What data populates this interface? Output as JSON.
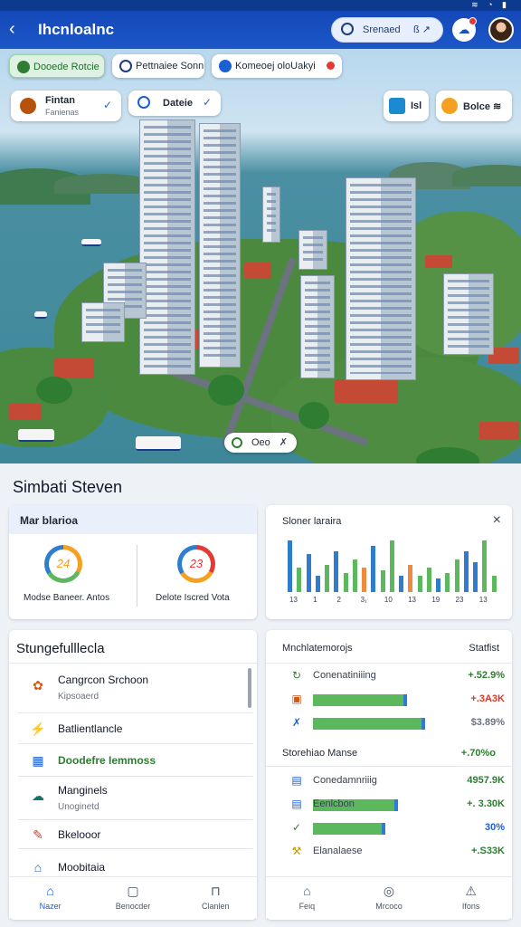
{
  "app": {
    "title": "Ihcnloalnc",
    "search_placeholder": "Srenaed",
    "search_extra": "ß ↗",
    "status_icons": "≋ ◔ ▮"
  },
  "map": {
    "chips_top": [
      {
        "label": "Dooede  Rotcie",
        "color": "#2e7d32"
      },
      {
        "label": "Pettnaiee Sonn",
        "color": "#1f3d7a"
      },
      {
        "label": "Komeoej oloUakyi",
        "color": "#1b5fd1"
      }
    ],
    "cards": [
      {
        "title": "Fintan",
        "subtitle": "Fanienas",
        "check": "✓"
      },
      {
        "title": "Dateie",
        "subtitle": "",
        "check": "✓"
      }
    ],
    "right_chips": [
      {
        "label": "Isl"
      },
      {
        "label": "Bolce ≋"
      }
    ],
    "badge": {
      "label": "Oeo",
      "suffix": "✗"
    }
  },
  "section": {
    "title": "Simbati Steven"
  },
  "metrics_panel": {
    "title": "Mar blarioa",
    "rings": [
      {
        "value": "24",
        "label": "Modse Baneer. Antos",
        "colors": [
          "#f4a020",
          "#5cb85c",
          "#2f7dd1"
        ]
      },
      {
        "value": "23",
        "label": "Delote Iscred Vota",
        "colors": [
          "#e53935",
          "#f4a020",
          "#2f7dd1"
        ]
      }
    ]
  },
  "chart_panel": {
    "close": "×",
    "chart_data": {
      "type": "bar",
      "title": "Sloner laraira",
      "tick_labels": [
        "13",
        "1",
        "2",
        "3₁",
        "10",
        "13",
        "19",
        "23",
        "13"
      ],
      "series_colors": [
        "#2f7dd1",
        "#5cb85c",
        "#f08a3c"
      ],
      "values": [
        0.95,
        0.45,
        0.7,
        0.3,
        0.5,
        0.75,
        0.35,
        0.6,
        0.45,
        0.85,
        0.4,
        0.95,
        0.3,
        0.5,
        0.3,
        0.45,
        0.25,
        0.35,
        0.6,
        0.75,
        0.55,
        0.95,
        0.3
      ],
      "colors_idx": [
        0,
        1,
        0,
        0,
        1,
        0,
        1,
        1,
        2,
        0,
        1,
        1,
        0,
        2,
        1,
        1,
        0,
        1,
        1,
        0,
        0,
        1,
        1
      ]
    }
  },
  "list_panel": {
    "title": "Stungefulllecla",
    "items": [
      {
        "icon": "✿",
        "icon_color": "#d4580f",
        "title": "Cangrcon Srchoon",
        "subtitle": "Kipsoaerd"
      },
      {
        "icon": "⚡",
        "icon_color": "#c59a00",
        "title": "Batlientlancle",
        "subtitle": ""
      },
      {
        "icon": "▦",
        "icon_color": "#1b5fd1",
        "title": "Doodefre Iemmoss",
        "subtitle": ""
      },
      {
        "icon": "☁",
        "icon_color": "#0f766e",
        "title": "Manginels",
        "subtitle": "Unoginetd"
      },
      {
        "icon": "✎",
        "icon_color": "#d23b2a",
        "title": "Bkelooor",
        "subtitle": ""
      },
      {
        "icon": "⌂",
        "icon_color": "#1b5fd1",
        "title": "Moobitaia",
        "subtitle": ""
      }
    ]
  },
  "stats_panel": {
    "title": "Mnchlatemorojs",
    "right_title": "Statfist",
    "group1": [
      {
        "icon": "↻",
        "icon_color": "#2e7d32",
        "label": "Conenatiniiing",
        "value": "+.52.9%",
        "value_color": "#2e7d32",
        "bar": 0
      },
      {
        "icon": "▣",
        "icon_color": "#d4580f",
        "label": "",
        "value": "+.3A3K",
        "value_color": "#d23b2a",
        "bar": 0.5
      },
      {
        "icon": "✗",
        "icon_color": "#1b5fd1",
        "label": "",
        "value": "$3.89%",
        "value_color": "#6b7280",
        "bar": 0.6
      }
    ],
    "group2_title": "Storehiao Manse",
    "group2_value": "+.70%o",
    "group2": [
      {
        "icon": "▤",
        "icon_color": "#1b5fd1",
        "label": "Conedamnriiig",
        "value": "4957.9K",
        "value_color": "#2e7d32",
        "bar": 0
      },
      {
        "icon": "▤",
        "icon_color": "#1b5fd1",
        "label": "Eenlcbon",
        "value": "+. 3.30K",
        "value_color": "#2e7d32",
        "bar": 0.45
      },
      {
        "icon": "✓",
        "icon_color": "#2e7d32",
        "label": "",
        "value": "30%",
        "value_color": "#1b5fd1",
        "bar": 0.38
      },
      {
        "icon": "⚒",
        "icon_color": "#c59a00",
        "label": "Elanalaese",
        "value": "+.S33K",
        "value_color": "#2e7d32",
        "bar": 0
      }
    ]
  },
  "tabs_left": [
    {
      "icon": "⌂",
      "label": "Nazer",
      "active": true
    },
    {
      "icon": "▢",
      "label": "Benocder",
      "active": false
    },
    {
      "icon": "⊓",
      "label": "Clanlen",
      "active": false
    }
  ],
  "tabs_right": [
    {
      "icon": "⌂",
      "label": "Feiq",
      "active": false
    },
    {
      "icon": "◎",
      "label": "Mrcoco",
      "active": false
    },
    {
      "icon": "⚠",
      "label": "Ifons",
      "active": false
    }
  ]
}
